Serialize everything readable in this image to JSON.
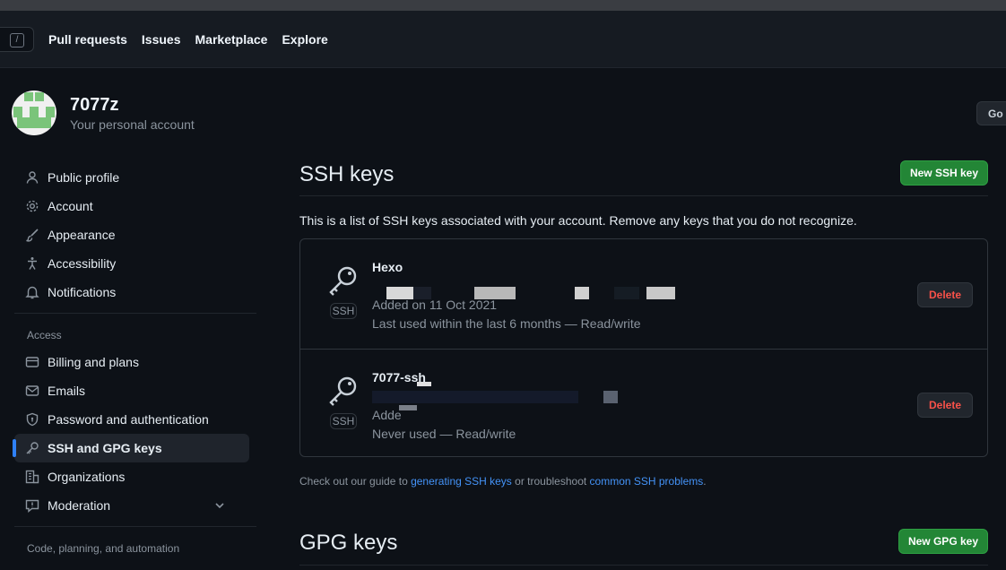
{
  "header": {
    "search_hint": "/",
    "nav": [
      "Pull requests",
      "Issues",
      "Marketplace",
      "Explore"
    ]
  },
  "account": {
    "name": "7077z",
    "subtitle": "Your personal account",
    "goto_label": "Go t"
  },
  "sidebar": {
    "items": [
      {
        "label": "Public profile",
        "icon": "person-icon"
      },
      {
        "label": "Account",
        "icon": "gear-icon"
      },
      {
        "label": "Appearance",
        "icon": "paintbrush-icon"
      },
      {
        "label": "Accessibility",
        "icon": "accessibility-icon"
      },
      {
        "label": "Notifications",
        "icon": "bell-icon"
      }
    ],
    "access_heading": "Access",
    "access_items": [
      {
        "label": "Billing and plans",
        "icon": "credit-card-icon"
      },
      {
        "label": "Emails",
        "icon": "mail-icon"
      },
      {
        "label": "Password and authentication",
        "icon": "shield-lock-icon"
      },
      {
        "label": "SSH and GPG keys",
        "icon": "key-icon",
        "active": true
      },
      {
        "label": "Organizations",
        "icon": "organization-icon"
      },
      {
        "label": "Moderation",
        "icon": "report-icon"
      }
    ],
    "code_heading": "Code, planning, and automation"
  },
  "ssh": {
    "title": "SSH keys",
    "new_button": "New SSH key",
    "description": "This is a list of SSH keys associated with your account. Remove any keys that you do not recognize.",
    "keys": [
      {
        "title": "Hexo",
        "badge": "SSH",
        "added": "Added on 11 Oct 2021",
        "last_used": "Last used within the last 6 months — Read/write",
        "delete": "Delete"
      },
      {
        "title": "7077-ssh",
        "badge": "SSH",
        "added": "Adde",
        "last_used": "Never used — Read/write",
        "delete": "Delete"
      }
    ],
    "guide": {
      "prefix": "Check out our guide to ",
      "link1": "generating SSH keys",
      "middle": " or troubleshoot ",
      "link2": "common SSH problems",
      "suffix": "."
    }
  },
  "gpg": {
    "title": "GPG keys",
    "new_button": "New GPG key"
  },
  "colors": {
    "background": "#0d1117",
    "header": "#161b22",
    "accent_green": "#238636",
    "danger": "#f85149",
    "link": "#4493f8",
    "active_indicator": "#2f81f7"
  }
}
